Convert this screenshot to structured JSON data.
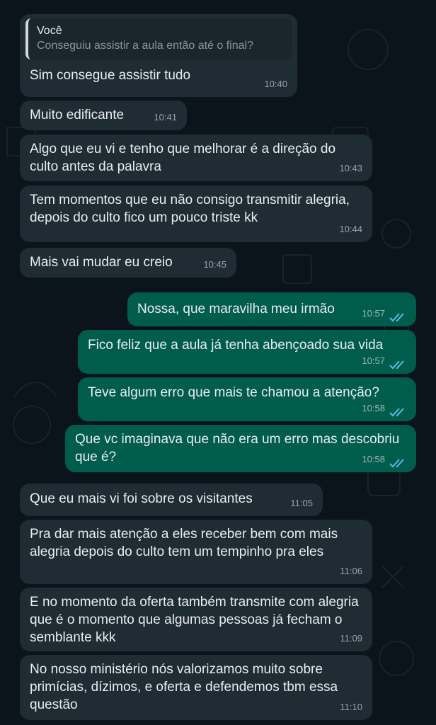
{
  "colors": {
    "background": "#0b141a",
    "incoming": "#1f2c34",
    "outgoing": "#005c4b",
    "tick_read": "#53bdeb"
  },
  "messages": [
    {
      "side": "in",
      "quote_author": "Você",
      "quote_text": "Conseguiu assistir a aula então até o final?",
      "text": "Sim consegue assistir tudo",
      "time": "10:40"
    },
    {
      "side": "in",
      "text": "Muito edificante",
      "time": "10:41"
    },
    {
      "side": "in",
      "text": "Algo que eu vi e tenho que melhorar é a direção do culto antes da palavra",
      "time": "10:43"
    },
    {
      "side": "in",
      "text": "Tem momentos que eu não consigo transmitir alegria, depois do culto fico um pouco triste kk",
      "time": "10:44"
    },
    {
      "side": "in",
      "text": "Mais vai mudar eu creio",
      "time": "10:45"
    },
    {
      "side": "out",
      "text": "Nossa, que maravilha meu irmão",
      "time": "10:57",
      "status": "read-ticks-icon"
    },
    {
      "side": "out",
      "text": "Fico feliz que a aula já tenha abençoado sua vida",
      "time": "10:57",
      "status": "read-ticks-icon"
    },
    {
      "side": "out",
      "text": "Teve algum erro que mais te chamou a atenção?",
      "time": "10:58",
      "status": "read-ticks-icon"
    },
    {
      "side": "out",
      "text": "Que vc imaginava que não era um erro mas descobriu que é?",
      "time": "10:58",
      "status": "read-ticks-icon"
    },
    {
      "side": "in",
      "text": "Que eu mais vi foi sobre os visitantes",
      "time": "11:05"
    },
    {
      "side": "in",
      "text": "Pra dar mais atenção a eles receber bem com mais alegria depois do culto tem um tempinho pra eles",
      "time": "11:06"
    },
    {
      "side": "in",
      "text": "E no momento da oferta também transmite com alegria que é o momento que algumas pessoas já fecham o semblante kkk",
      "time": "11:09"
    },
    {
      "side": "in",
      "text": "No nosso ministério nós valorizamos muito sobre primícias, dízimos, e oferta e defendemos tbm essa questão",
      "time": "11:10"
    }
  ]
}
